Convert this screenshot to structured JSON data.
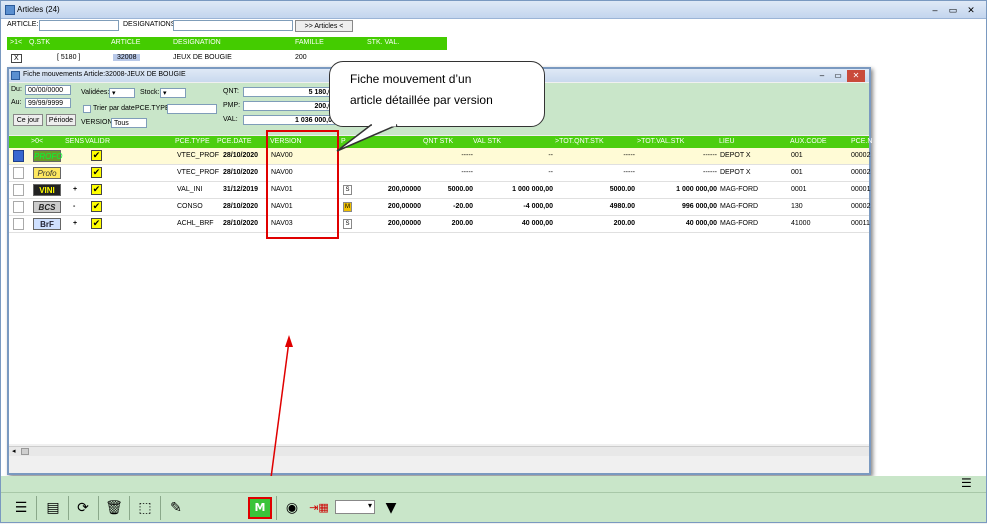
{
  "outer_title": "Articles (24)",
  "filters": {
    "article_label": "ARTICLE:",
    "designations_label": "DESIGNATIONS:",
    "articles_button": ">> Articles <"
  },
  "top_grid": {
    "headers": [
      ">1<",
      "Q.STK",
      "ARTICLE",
      "DESIGNATION",
      "FAMILLE",
      "STK. VAL."
    ],
    "row": {
      "x": "X",
      "qstk": "[ 5180 ]",
      "article": "32008",
      "designation": "JEUX DE BOUGIE",
      "famille": "200"
    }
  },
  "inner": {
    "title": "Fiche mouvements Article:32008-JEUX DE BOUGIE",
    "du_label": "Du:",
    "du_value": "00/00/0000",
    "au_label": "Au:",
    "au_value": "99/99/9999",
    "validees_label": "Validées:",
    "stock_label": "Stock:",
    "trier_label": "Trier par date",
    "pcetype_label": "PCE.TYPE:",
    "version_label": "VERSION:",
    "version_value": "Tous",
    "cejour_button": "Ce jour",
    "periode_button": "Période",
    "qnt_label": "QNT:",
    "qnt_value": "5 180,0",
    "pmp_label": "PMP:",
    "pmp_value": "200,0",
    "val_label": "VAL:",
    "val_value": "1 036 000,0",
    "headers": [
      ">0<",
      "SENS",
      "VALID",
      "R",
      "PCE.TYPE",
      "PCE.DATE",
      "VERSION",
      "P",
      "QNT STK",
      "VAL STK",
      ">TOT.QNT.STK",
      ">TOT.VAL.STK",
      "LIEU",
      "AUX.CODE",
      "PCE.N"
    ],
    "rows": [
      {
        "icon": "PROFO",
        "sens": "",
        "pcetype": "VTEC_PROF",
        "date": "28/10/2020",
        "version": "NAV00",
        "badge": "",
        "price": "",
        "qntstk": "-----",
        "valstk": "--",
        "totqnt": "-----",
        "totval": "------",
        "lieu": "DEPOT X",
        "aux": "001",
        "pcen": "00002"
      },
      {
        "icon": "Profo",
        "sens": "",
        "pcetype": "VTEC_PROF",
        "date": "28/10/2020",
        "version": "NAV00",
        "badge": "",
        "price": "",
        "qntstk": "-----",
        "valstk": "--",
        "totqnt": "-----",
        "totval": "------",
        "lieu": "DEPOT X",
        "aux": "001",
        "pcen": "00002"
      },
      {
        "icon": "VINI",
        "sens": "+",
        "pcetype": "VAL_INI",
        "date": "31/12/2019",
        "version": "NAV01",
        "badge": "S",
        "price": "200,00000",
        "qntstk": "5000.00",
        "valstk": "1 000 000,00",
        "totqnt": "5000.00",
        "totval": "1 000 000,00",
        "lieu": "MAG-FORD",
        "aux": "0001",
        "pcen": "00001"
      },
      {
        "icon": "BCS",
        "sens": "-",
        "pcetype": "CONSO",
        "date": "28/10/2020",
        "version": "NAV01",
        "badge": "M",
        "price": "200,00000",
        "qntstk": "-20.00",
        "valstk": "-4 000,00",
        "totqnt": "4980.00",
        "totval": "996 000,00",
        "lieu": "MAG-FORD",
        "aux": "130",
        "pcen": "00002"
      },
      {
        "icon": "BrF",
        "sens": "+",
        "pcetype": "ACHL_BRF",
        "date": "28/10/2020",
        "version": "NAV03",
        "badge": "S",
        "price": "200,00000",
        "qntstk": "200.00",
        "valstk": "40 000,00",
        "totqnt": "200.00",
        "totval": "40 000,00",
        "lieu": "MAG-FORD",
        "aux": "41000",
        "pcen": "00011"
      }
    ]
  },
  "callout": {
    "line1": "Fiche mouvement  d’un",
    "line2": "article détaillée par version"
  },
  "colors": {
    "header_green": "#4cce10",
    "panel_green": "#c9e6c9",
    "highlight_red": "#e00000"
  }
}
